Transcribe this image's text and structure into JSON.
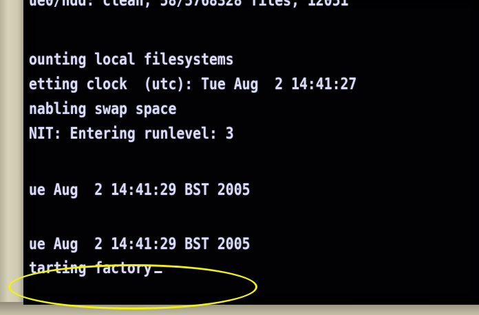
{
  "terminal": {
    "lines": [
      "ue0/hdd: clean, 58/5768328 files, 12051",
      "ounting local filesystems",
      "etting clock  (utc): Tue Aug  2 14:41:27",
      "nabling swap space",
      "NIT: Entering runlevel: 3",
      "ue Aug  2 14:41:29 BST 2005",
      "ue Aug  2 14:41:29 BST 2005",
      "tarting factory"
    ]
  },
  "annotation": {
    "color": "#f0f014",
    "target": "tarting factory"
  },
  "colors": {
    "text": "#dcdcf2",
    "screen": "#020204",
    "bezel": "#c9c4ad"
  }
}
